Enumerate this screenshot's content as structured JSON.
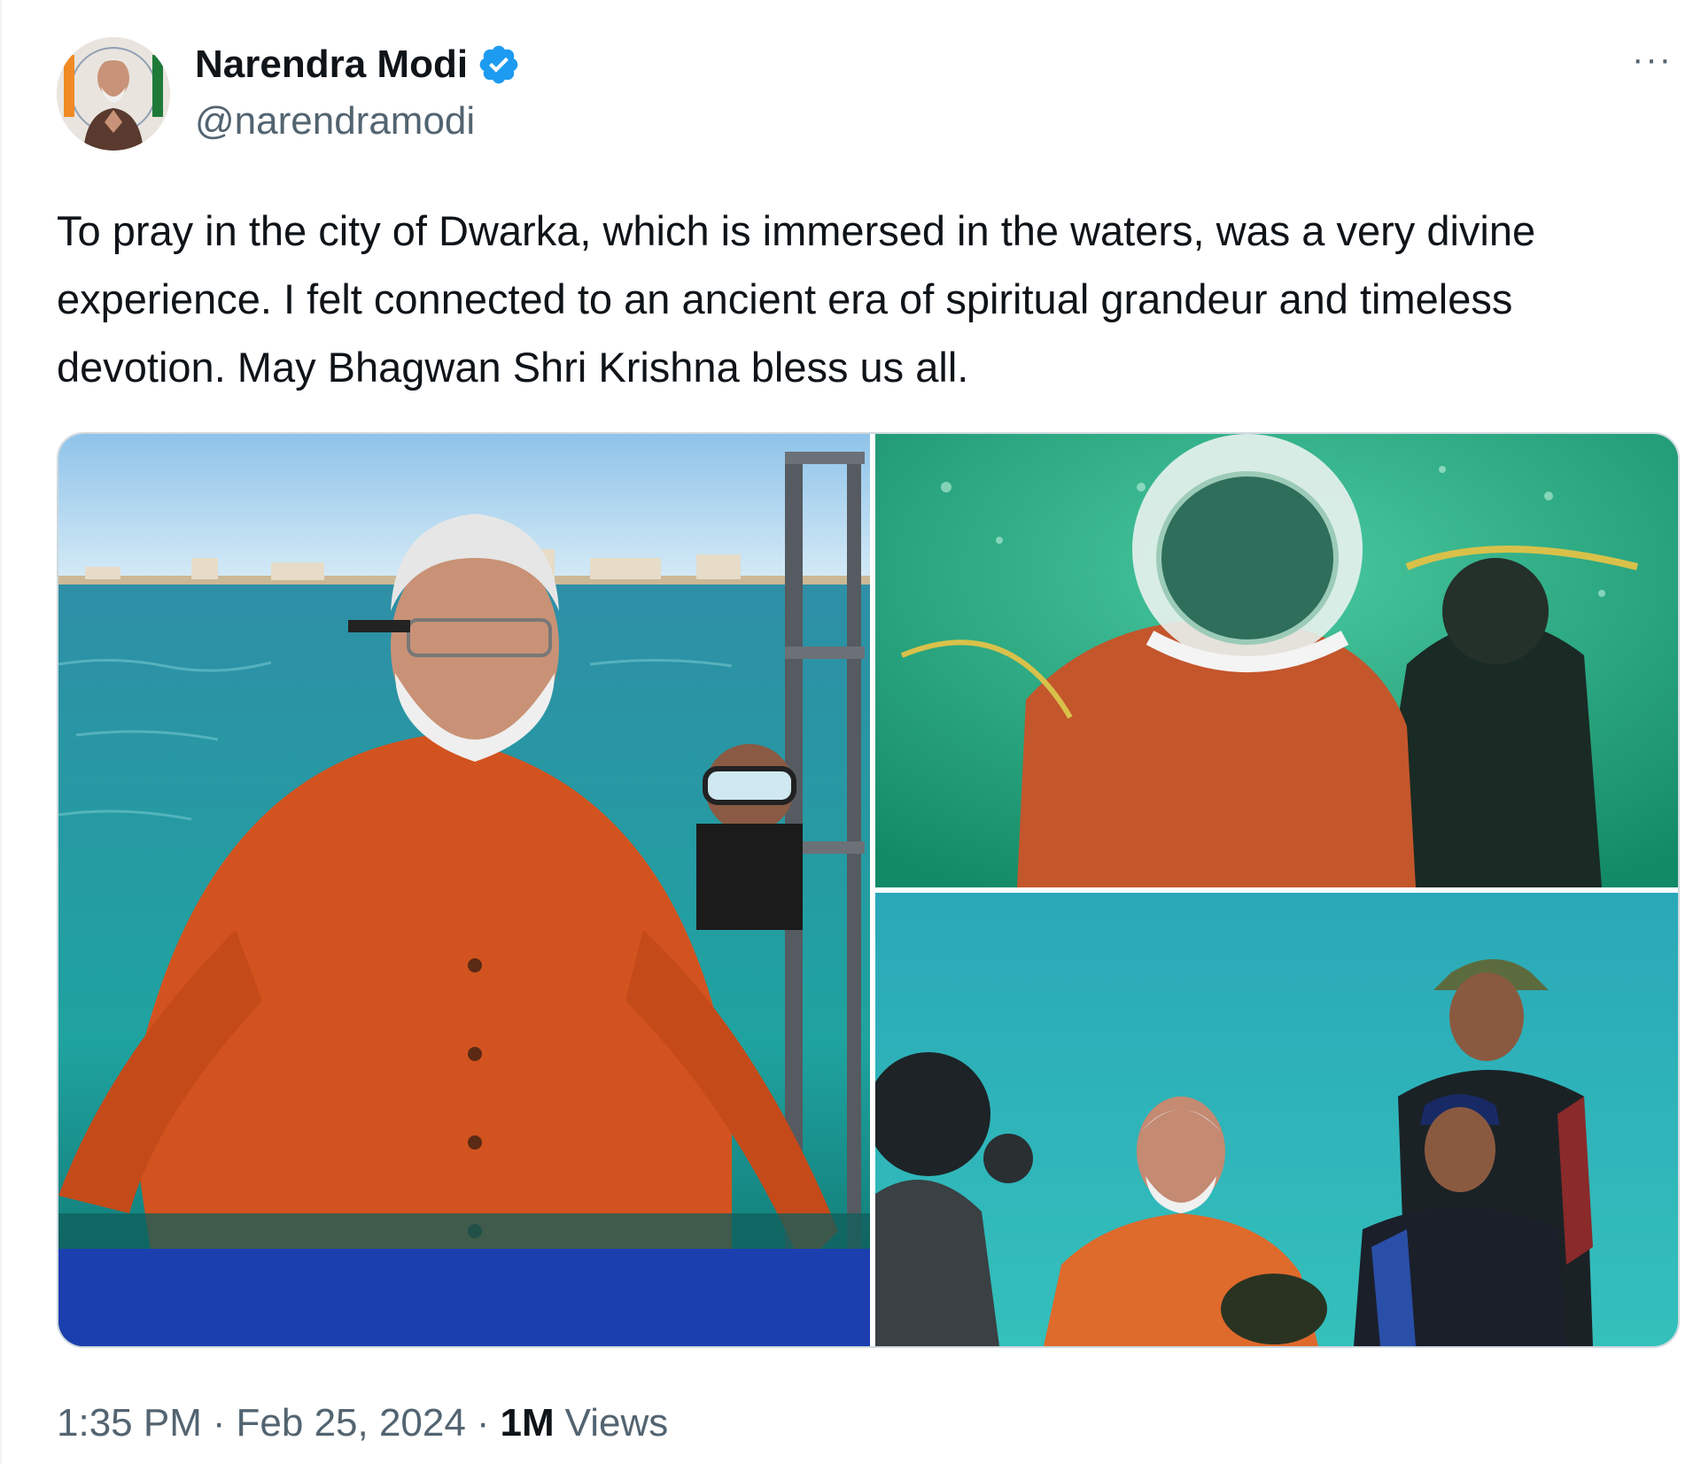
{
  "author": {
    "name": "Narendra Modi",
    "handle": "@narendramodi",
    "verified": true,
    "verified_icon": "verified-badge-icon",
    "verified_color": "#1d9bf0"
  },
  "more_icon": "more-options-icon",
  "more_label": "···",
  "tweet": {
    "text": "To pray in the city of Dwarka, which is immersed in the waters, was a very divine experience. I felt connected to an ancient era of spiritual grandeur and timeless devotion. May Bhagwan Shri Krishna bless us all."
  },
  "footer": {
    "time": "1:35 PM",
    "separator": "·",
    "date": "Feb 25, 2024",
    "views_count": "1M",
    "views_label": "Views"
  }
}
